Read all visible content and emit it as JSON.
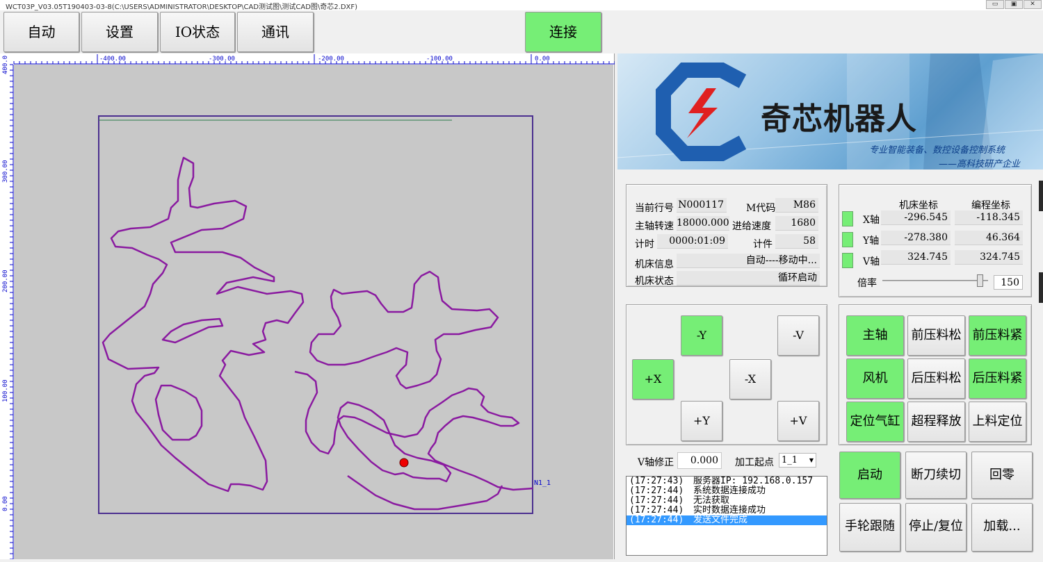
{
  "window": {
    "title": "WCT03P_V03.05T190403-03-8(C:\\USERS\\ADMINISTRATOR\\DESKTOP\\CAD测试图\\测试CAD图\\奇芯2.DXF)",
    "minimize_label": "▭",
    "restore_label": "▣",
    "close_label": "✕"
  },
  "toolbar": {
    "auto": "自动",
    "settings": "设置",
    "io_status": "IO状态",
    "comm": "通讯",
    "connect": "连接"
  },
  "ruler": {
    "x_labels": [
      "-400.00",
      "-300.00",
      "-200.00",
      "-100.00",
      "0.00"
    ],
    "y_labels": [
      "400.0",
      "300.00",
      "200.00",
      "100.00",
      "0.00"
    ]
  },
  "canvas": {
    "path_label": "N1_1"
  },
  "banner": {
    "company": "奇芯机器人",
    "slogan1": "专业智能装备、数控设备控制系统",
    "slogan2": "——高科技研产企业"
  },
  "status": {
    "line_label": "当前行号",
    "line_value": "N000117",
    "mcode_label": "M代码",
    "mcode_value": "M86",
    "spindle_label": "主轴转速",
    "spindle_value": "18000.000",
    "feed_label": "进给速度",
    "feed_value": "1680",
    "timer_label": "计时",
    "timer_value": "0000:01:09",
    "count_label": "计件",
    "count_value": "58",
    "info_label": "机床信息",
    "info_value": "自动----移动中...",
    "state_label": "机床状态",
    "state_value": "循环启动"
  },
  "coords": {
    "machine_header": "机床坐标",
    "program_header": "编程坐标",
    "axes": [
      {
        "name": "X轴",
        "machine": "-296.545",
        "program": "-118.345"
      },
      {
        "name": "Y轴",
        "machine": "-278.380",
        "program": "46.364"
      },
      {
        "name": "V轴",
        "machine": "324.745",
        "program": "324.745"
      }
    ],
    "rate_label": "倍率",
    "rate_value": "150",
    "rate_fraction": 0.95
  },
  "jog": {
    "minus_y": "-Y",
    "minus_v": "-V",
    "plus_x": "+X",
    "minus_x": "-X",
    "plus_y": "+Y",
    "plus_v": "+V"
  },
  "functions": [
    {
      "label": "主轴",
      "active": true
    },
    {
      "label": "前压料松",
      "active": false
    },
    {
      "label": "前压料紧",
      "active": true
    },
    {
      "label": "风机",
      "active": true
    },
    {
      "label": "后压料松",
      "active": false
    },
    {
      "label": "后压料紧",
      "active": true
    },
    {
      "label": "定位气缸",
      "active": true
    },
    {
      "label": "超程释放",
      "active": false
    },
    {
      "label": "上料定位",
      "active": false
    }
  ],
  "vfix": {
    "label": "V轴修正",
    "value": "0.000",
    "start_label": "加工起点",
    "start_value": "1_1"
  },
  "log": [
    {
      "time": "(17:27:43)",
      "msg": "服务器IP: 192.168.0.157",
      "selected": false
    },
    {
      "time": "(17:27:44)",
      "msg": "系统数据连接成功",
      "selected": false
    },
    {
      "time": "(17:27:44)",
      "msg": "无法获取",
      "selected": false
    },
    {
      "time": "(17:27:44)",
      "msg": "实时数据连接成功",
      "selected": false
    },
    {
      "time": "(17:27:44)",
      "msg": "发送文件完成",
      "selected": true
    }
  ],
  "actions": {
    "start": "启动",
    "resume": "断刀续切",
    "home": "回零",
    "handwheel": "手轮跟随",
    "stop": "停止/复位",
    "load": "加载..."
  }
}
